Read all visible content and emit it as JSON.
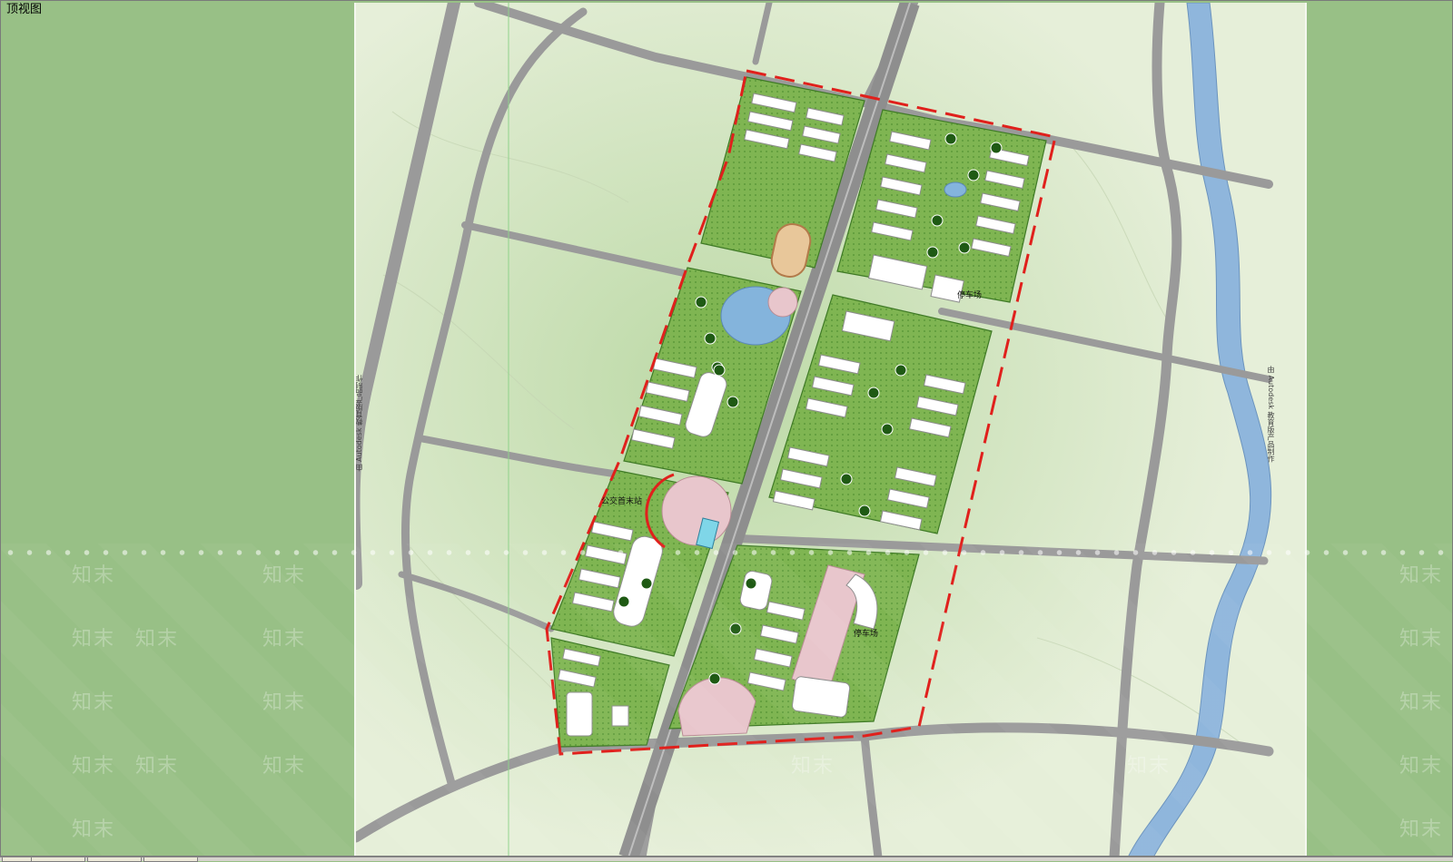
{
  "window": {
    "view_label": "顶视图"
  },
  "plan": {
    "side_label_left": "由 Autodesk 教育版产品制作",
    "side_label_right": "由 Autodesk 教育版产品制作",
    "labels": {
      "parking_north": "停车场",
      "parking_south": "停车场",
      "transit_center": "公交首末站"
    }
  },
  "watermark": {
    "text": "知末"
  },
  "tabs": [
    {
      "label": ""
    },
    {
      "label": ""
    },
    {
      "label": ""
    },
    {
      "label": ""
    }
  ],
  "colors": {
    "viewport_bg": "#98c086",
    "sheet_bg": "#e7efd9",
    "site_boundary": "#e0201c",
    "road": "#9a9a9a",
    "river": "#8fb6dc",
    "lawn": "#7fb552",
    "dark_green": "#2f6a1f",
    "building": "#ffffff"
  }
}
